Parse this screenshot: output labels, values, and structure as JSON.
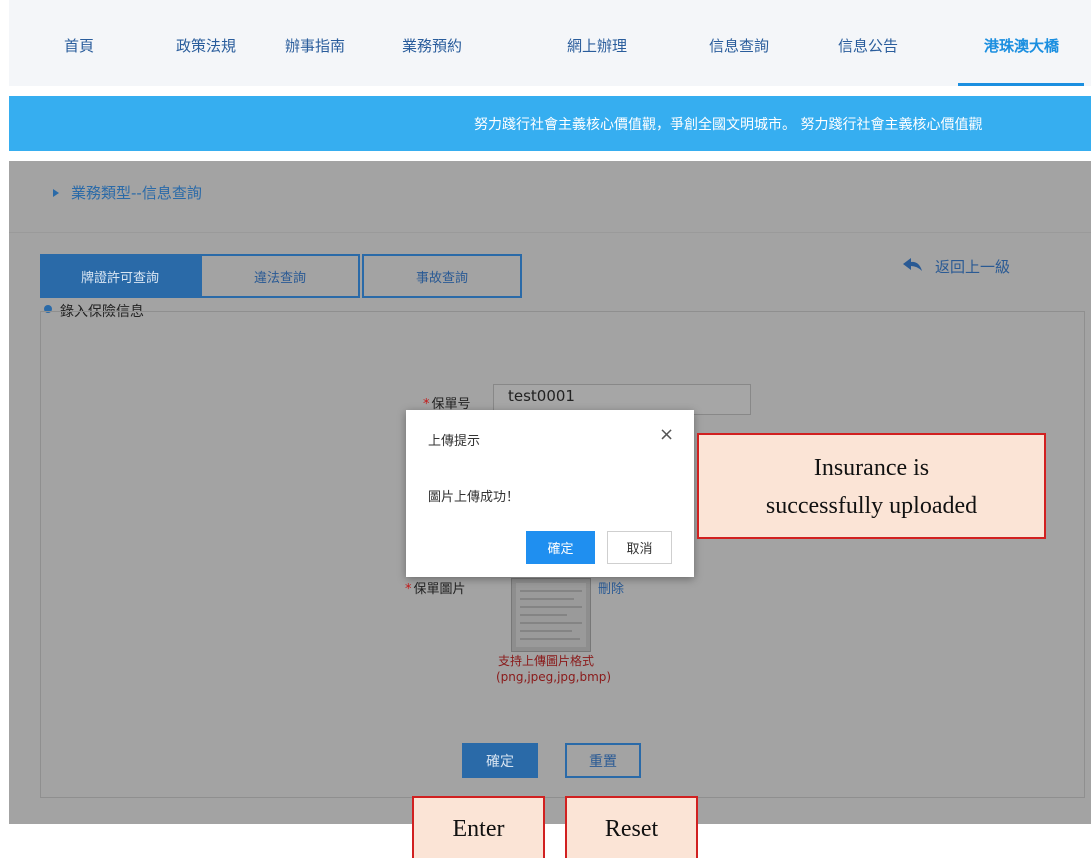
{
  "nav": {
    "items": [
      "首頁",
      "政策法規",
      "辦事指南",
      "業務預約",
      "網上辦理",
      "信息查詢",
      "信息公告",
      "港珠澳大橋"
    ],
    "active_index": 7
  },
  "banner": {
    "text": "努力踐行社會主義核心價值觀，爭創全國文明城市。    努力踐行社會主義核心價值觀"
  },
  "breadcrumb": "業務類型--信息查詢",
  "tabs": [
    "牌證許可查詢",
    "違法查詢",
    "事故查詢"
  ],
  "back_link": "返回上一級",
  "section_title": "錄入保險信息",
  "form": {
    "policy_label": "保單号",
    "policy_value": "test0001",
    "image_label": "保單圖片",
    "delete_label": "刪除",
    "support_line1": "支持上傳圖片格式",
    "support_line2": "(png,jpeg,jpg,bmp)",
    "confirm_label": "確定",
    "reset_label": "重置"
  },
  "dialog": {
    "title": "上傳提示",
    "close": "×",
    "message": "圖片上傳成功！",
    "ok_label": "確定",
    "cancel_label": "取消"
  },
  "callouts": {
    "uploaded_line1": "Insurance is",
    "uploaded_line2": "successfully uploaded",
    "enter": "Enter",
    "reset": "Reset"
  },
  "colors": {
    "accent": "#1b8fe0",
    "banner": "#36aef0",
    "overlay_grey": "#a3a3a3",
    "callout_border": "#d12020",
    "callout_fill": "#fbe4d6"
  }
}
